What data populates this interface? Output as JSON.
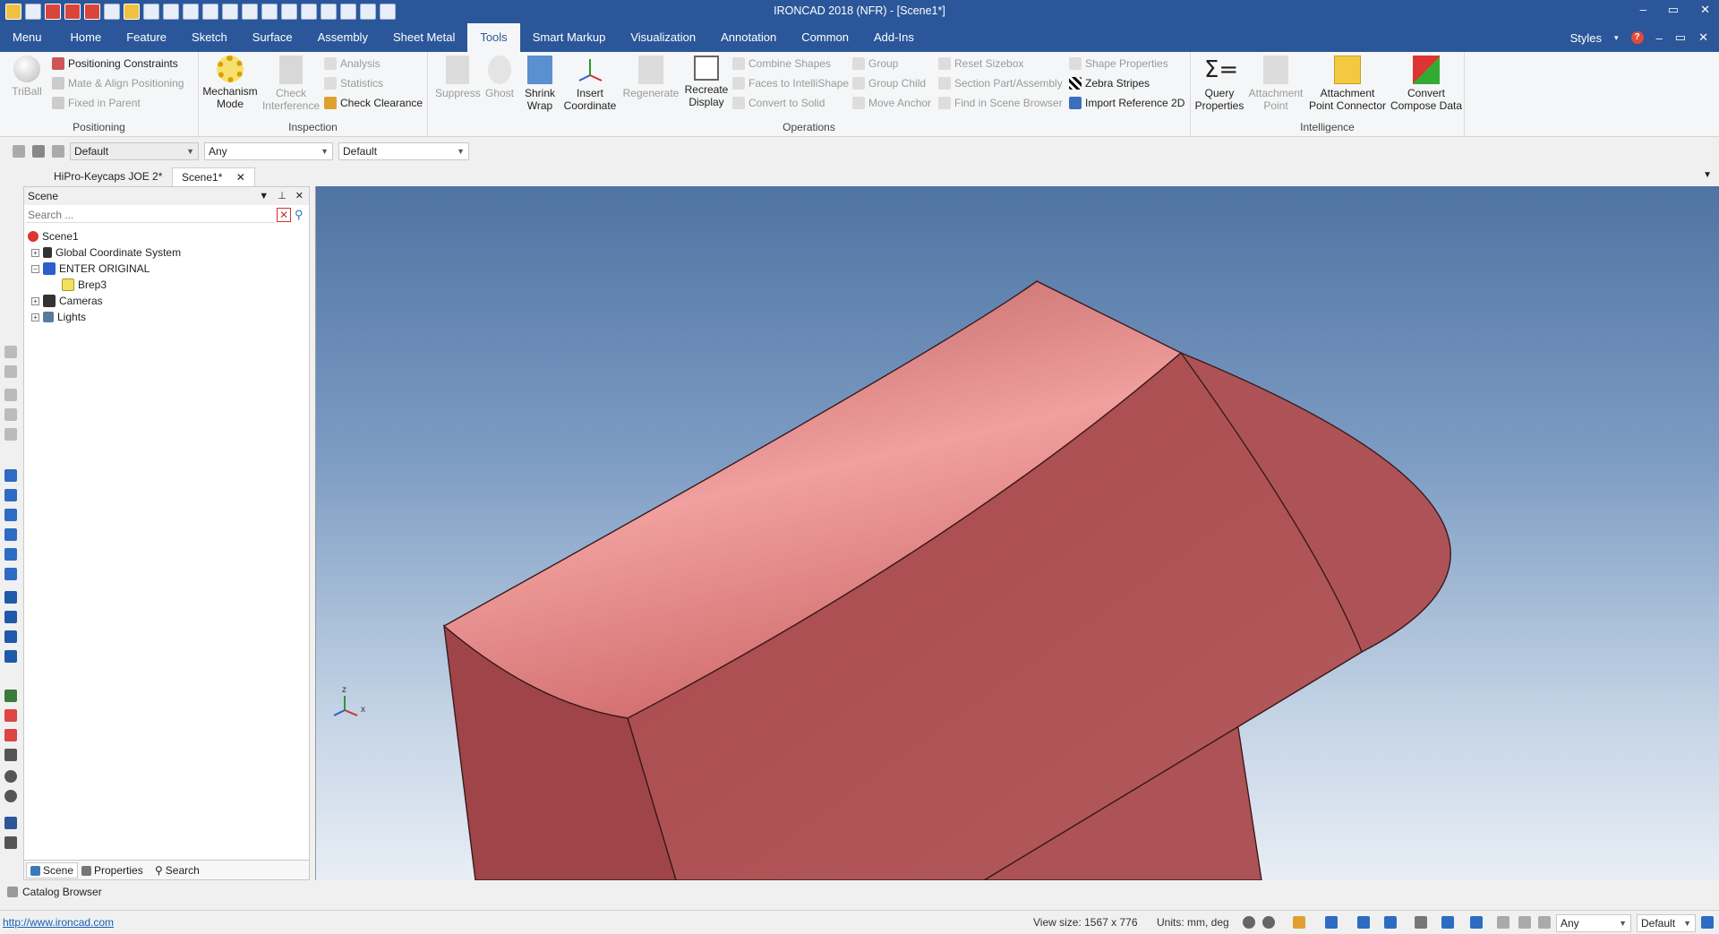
{
  "window": {
    "title": "IRONCAD 2018 (NFR) - [Scene1*]",
    "controls": [
      "–",
      "▭",
      "✕"
    ]
  },
  "ribbon_tabs": [
    "Menu",
    "Home",
    "Feature",
    "Sketch",
    "Surface",
    "Assembly",
    "Sheet Metal",
    "Tools",
    "Smart Markup",
    "Visualization",
    "Annotation",
    "Common",
    "Add-Ins"
  ],
  "active_tab": "Tools",
  "styles_label": "Styles",
  "ribbon": {
    "positioning": {
      "label": "Positioning",
      "triball": "TriBall",
      "positioning_constraints": "Positioning Constraints",
      "mate_align": "Mate & Align Positioning",
      "fixed_in_parent": "Fixed in Parent"
    },
    "inspection": {
      "label": "Inspection",
      "mechanism_mode_1": "Mechanism",
      "mechanism_mode_2": "Mode",
      "check_interference_1": "Check",
      "check_interference_2": "Interference",
      "analysis": "Analysis",
      "statistics": "Statistics",
      "check_clearance": "Check Clearance"
    },
    "operations": {
      "label": "Operations",
      "suppress": "Suppress",
      "ghost": "Ghost",
      "shrink_wrap_1": "Shrink",
      "shrink_wrap_2": "Wrap",
      "insert_coordinate_1": "Insert",
      "insert_coordinate_2": "Coordinate",
      "regenerate": "Regenerate",
      "recreate_display_1": "Recreate",
      "recreate_display_2": "Display",
      "combine_shapes": "Combine Shapes",
      "faces_to_intellishape": "Faces to IntelliShape",
      "convert_to_solid": "Convert to Solid",
      "group": "Group",
      "group_child": "Group Child",
      "move_anchor": "Move Anchor",
      "reset_sizebox": "Reset Sizebox",
      "section_part": "Section Part/Assembly",
      "find_in_scene": "Find in Scene Browser",
      "shape_properties": "Shape Properties",
      "zebra_stripes": "Zebra Stripes",
      "import_reference": "Import Reference 2D"
    },
    "intelligence": {
      "label": "Intelligence",
      "query_properties_1": "Query",
      "query_properties_2": "Properties",
      "attachment_point_1": "Attachment",
      "attachment_point_2": "Point",
      "attachment_connector_1": "Attachment",
      "attachment_connector_2": "Point Connector",
      "convert_compose_1": "Convert",
      "convert_compose_2": "Compose Data"
    }
  },
  "toolbar": {
    "combo1": "Default",
    "combo2": "Any",
    "combo3": "Default"
  },
  "doc_tabs": [
    "HiPro-Keycaps JOE 2*",
    "Scene1*"
  ],
  "scene_panel": {
    "title": "Scene",
    "search_placeholder": "Search ...",
    "tree": [
      {
        "label": "Scene1",
        "level": 0
      },
      {
        "label": "Global Coordinate System",
        "level": 1
      },
      {
        "label": "ENTER ORIGINAL",
        "level": 1
      },
      {
        "label": "Brep3",
        "level": 2
      },
      {
        "label": "Cameras",
        "level": 1
      },
      {
        "label": "Lights",
        "level": 1
      }
    ],
    "bottom_tabs": [
      "Scene",
      "Properties",
      "Search"
    ]
  },
  "viewport": {
    "axis_labels": [
      "z",
      "x"
    ]
  },
  "catalog_browser": "Catalog Browser",
  "status": {
    "link": "http://www.ironcad.com",
    "view_size": "View size: 1567 x  776",
    "units": "Units: mm, deg",
    "combo1": "Any",
    "combo2": "Default"
  },
  "colors": {
    "brand_blue": "#2b579a",
    "part_face": "#b05457",
    "part_top": "#e58a89"
  }
}
